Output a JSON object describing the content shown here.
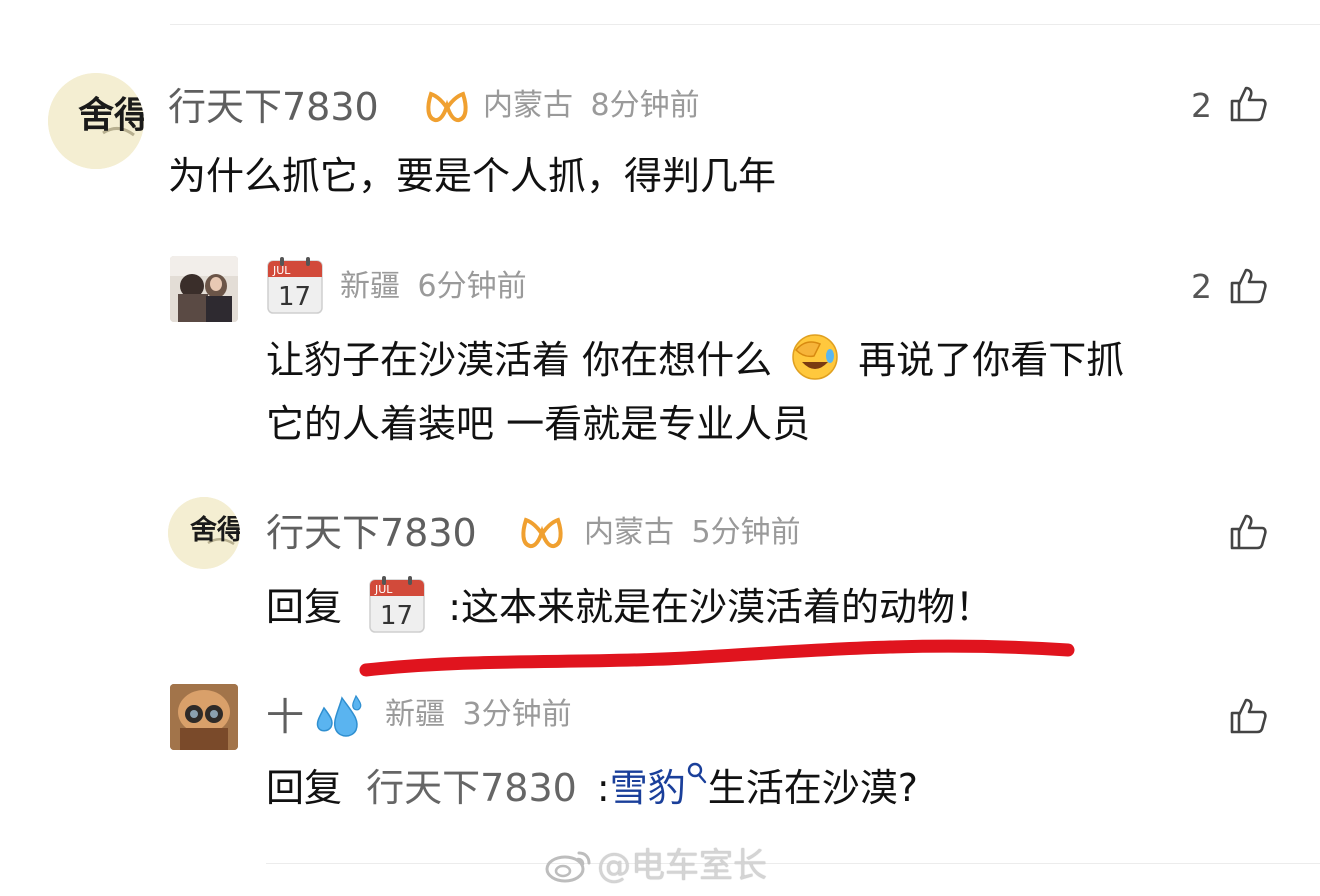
{
  "comments": [
    {
      "username": "行天下7830",
      "location": "内蒙古",
      "time": "8分钟前",
      "likes": "2",
      "text": "为什么抓它，要是个人抓，得判几年",
      "avatar_chars": "舍得"
    },
    {
      "calendar_month": "JUL",
      "calendar_day": "17",
      "location": "新疆",
      "time": "6分钟前",
      "likes": "2",
      "text_line1": "让豹子在沙漠活着 你在想什么",
      "text_line1b": "再说了你看下抓",
      "text_line2": "它的人着装吧  一看就是专业人员"
    },
    {
      "username": "行天下7830",
      "location": "内蒙古",
      "time": "5分钟前",
      "reply_label": "回复",
      "reply_text": ":这本来就是在沙漠活着的动物！",
      "calendar_month": "JUL",
      "calendar_day": "17",
      "avatar_chars": "舍得"
    },
    {
      "username": "十",
      "location": "新疆",
      "time": "3分钟前",
      "reply_label": "回复",
      "reply_to": "行天下7830",
      "reply_colon": ":",
      "link_text": "雪豹",
      "reply_tail": "生活在沙漠?"
    }
  ],
  "watermark": "@电车室长",
  "colors": {
    "underline": "#e0141e",
    "vip_badge": "#f0a030",
    "link": "#1a3f9a"
  }
}
